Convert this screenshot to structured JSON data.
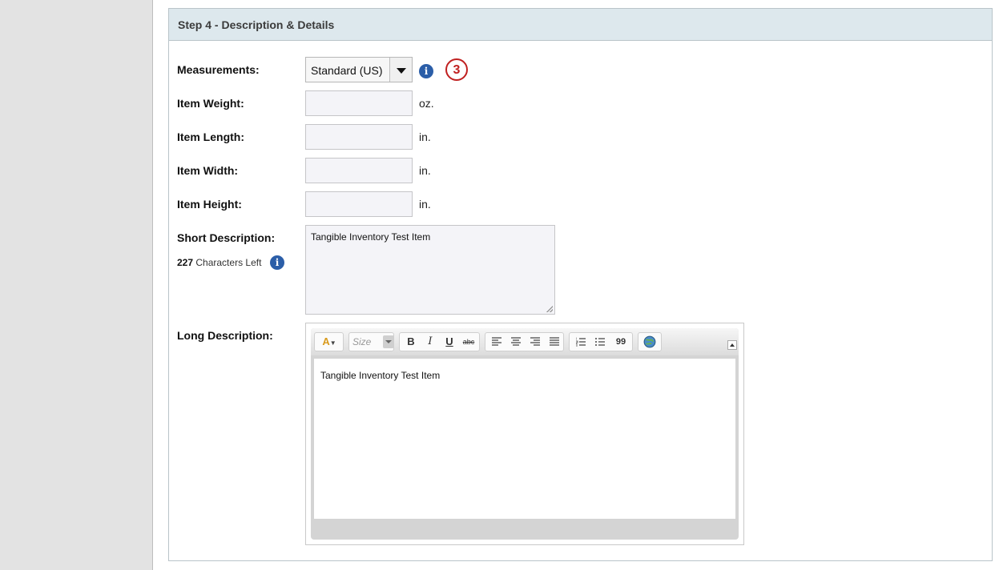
{
  "step": {
    "title": "Step 4 - Description & Details"
  },
  "measurements": {
    "label": "Measurements:",
    "selected": "Standard (US)",
    "badge": "3",
    "info_icon": "info-icon"
  },
  "fields": [
    {
      "label": "Item Weight:",
      "value": "",
      "unit": "oz."
    },
    {
      "label": "Item Length:",
      "value": "",
      "unit": "in."
    },
    {
      "label": "Item Width:",
      "value": "",
      "unit": "in."
    },
    {
      "label": "Item Height:",
      "value": "",
      "unit": "in."
    }
  ],
  "short_description": {
    "label": "Short Description:",
    "value": "Tangible Inventory Test Item",
    "chars_left_count": "227",
    "chars_left_text": "Characters Left"
  },
  "long_description": {
    "label": "Long Description:",
    "value": "Tangible Inventory Test Item",
    "toolbar": {
      "size_placeholder": "Size",
      "bold": "B",
      "italic": "I",
      "underline": "U",
      "strike": "abc",
      "quote": "99"
    }
  },
  "colors": {
    "header_bg": "#dde8ed",
    "info_blue": "#2b5ea8",
    "badge_red": "#c02020"
  }
}
